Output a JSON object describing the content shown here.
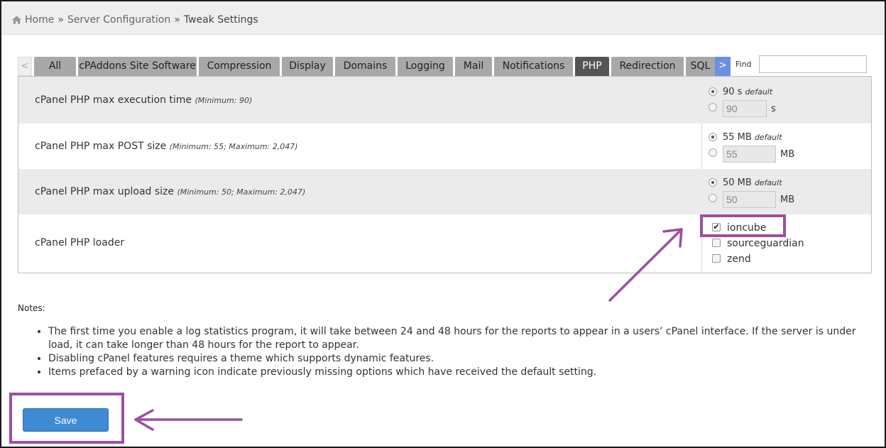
{
  "breadcrumb": {
    "home": "Home",
    "separator": "»",
    "section": "Server Configuration",
    "current": "Tweak Settings"
  },
  "tabs": {
    "prev_arrow": "<",
    "next_arrow": ">",
    "items": [
      "All",
      "cPAddons Site Software",
      "Compression",
      "Display",
      "Domains",
      "Logging",
      "Mail",
      "Notifications",
      "PHP",
      "Redirection",
      "SQL"
    ],
    "active": "PHP"
  },
  "find": {
    "label": "Find",
    "value": ""
  },
  "settings": [
    {
      "label": "cPanel PHP max execution time",
      "hint": "(Minimum: 90)",
      "default_value": "90 s",
      "default_tag": "default",
      "custom_value": "90",
      "unit": "s"
    },
    {
      "label": "cPanel PHP max POST size",
      "hint": "(Minimum: 55; Maximum: 2,047)",
      "default_value": "55 MB",
      "default_tag": "default",
      "custom_value": "55",
      "unit": "MB"
    },
    {
      "label": "cPanel PHP max upload size",
      "hint": "(Minimum: 50; Maximum: 2,047)",
      "default_value": "50 MB",
      "default_tag": "default",
      "custom_value": "50",
      "unit": "MB"
    }
  ],
  "loader": {
    "label": "cPanel PHP loader",
    "options": [
      {
        "name": "ioncube",
        "checked": true
      },
      {
        "name": "sourceguardian",
        "checked": false
      },
      {
        "name": "zend",
        "checked": false
      }
    ]
  },
  "notes": {
    "title": "Notes:",
    "items": [
      "The first time you enable a log statistics program, it will take between 24 and 48 hours for the reports to appear in a users’ cPanel interface. If the server is under load, it can take longer than 48 hours for the report to appear.",
      "Disabling cPanel features requires a theme which supports dynamic features.",
      "Items prefaced by a warning icon indicate previously missing options which have received the default setting."
    ]
  },
  "save_label": "Save",
  "colors": {
    "annotation": "#9c4fa3",
    "tab_inactive": "#a8a8a8",
    "tab_active": "#555555",
    "save_button": "#3d8bd2",
    "next_arrow": "#6c8fe3"
  }
}
